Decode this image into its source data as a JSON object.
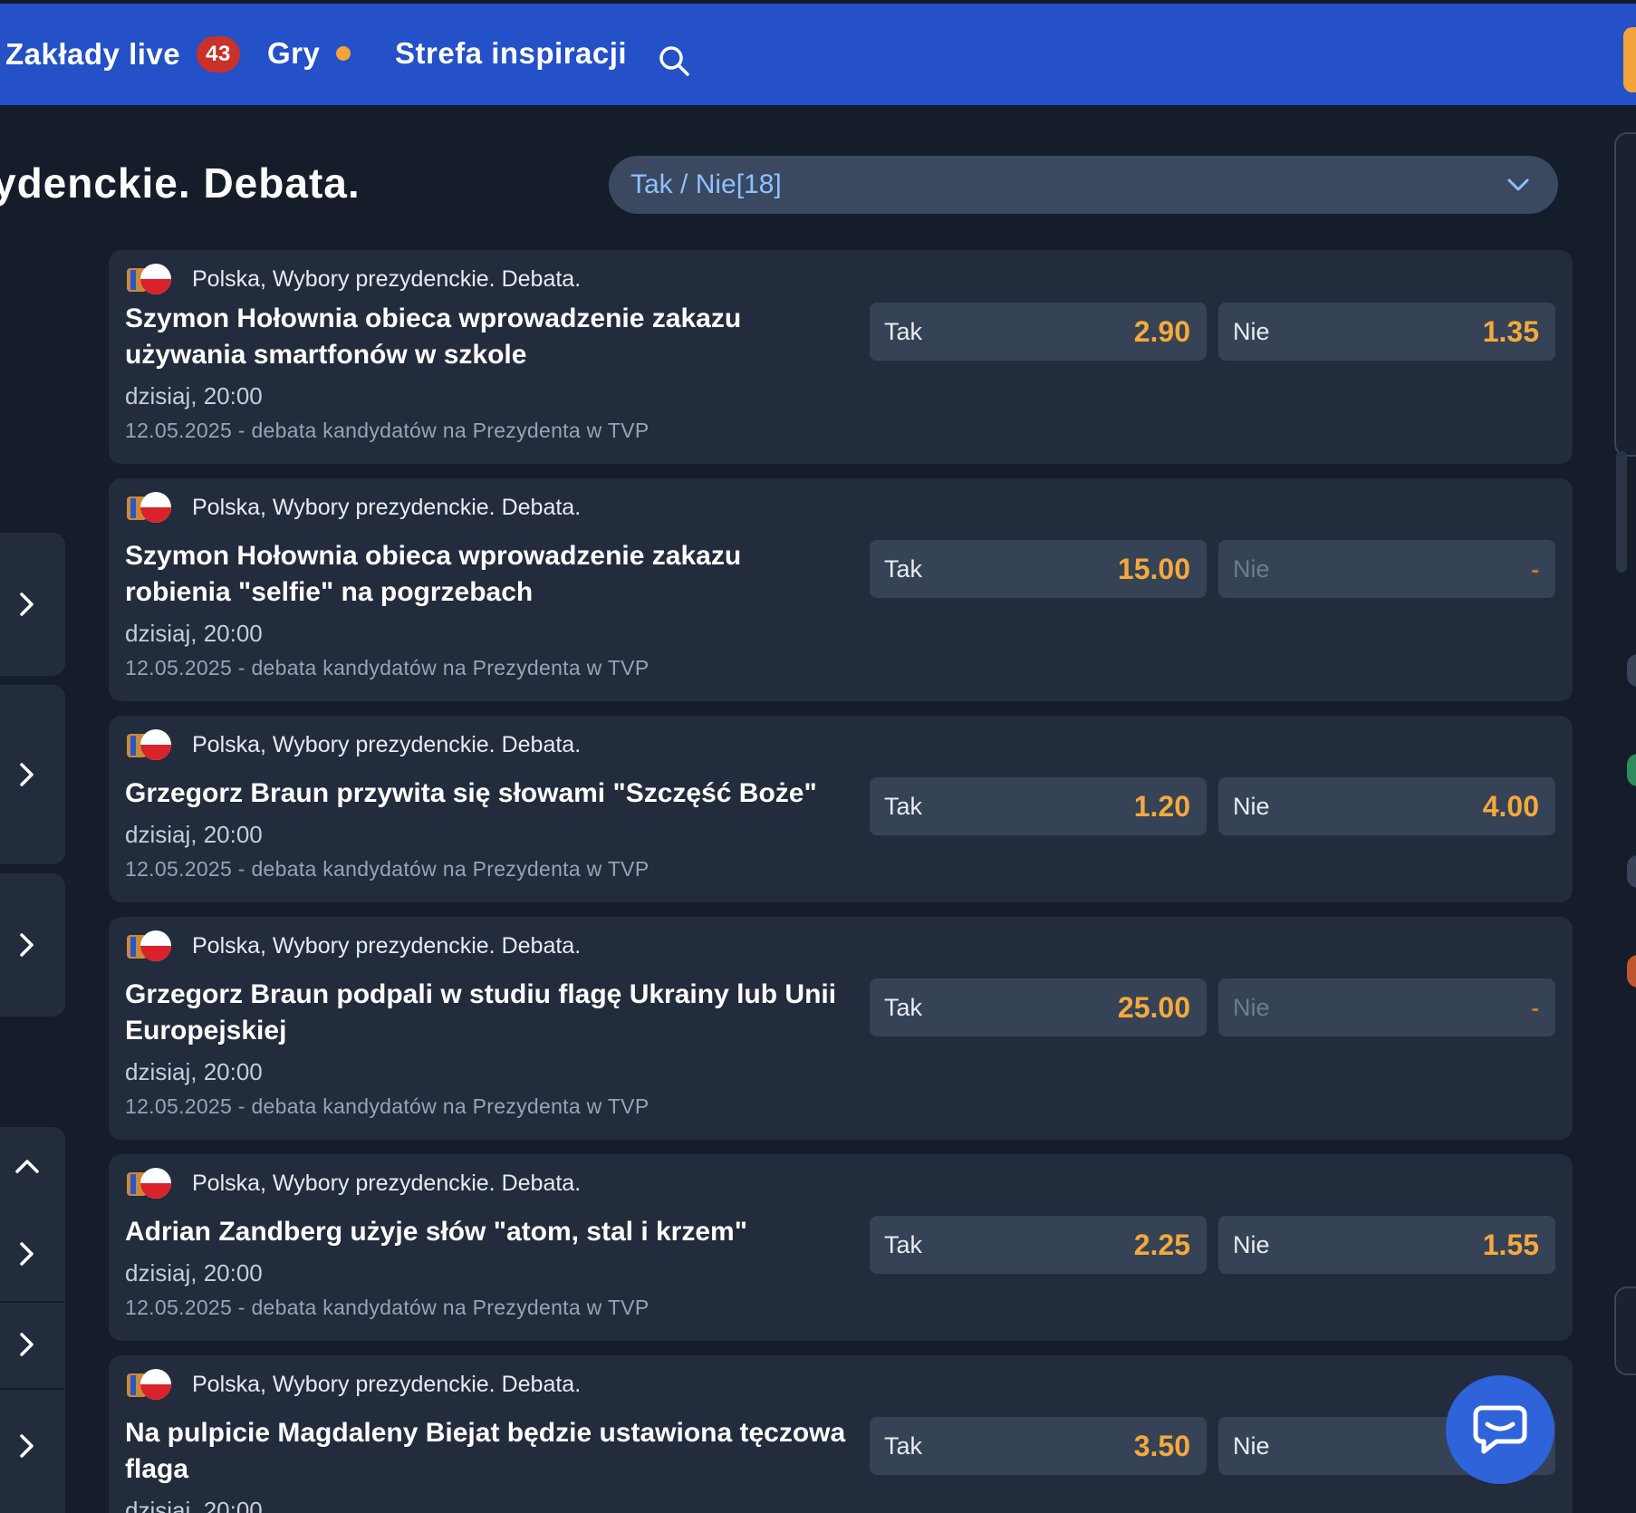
{
  "nav": {
    "items": [
      {
        "label": "Zakłady live",
        "badge": "43"
      },
      {
        "label": "Gry"
      },
      {
        "label": "Strefa inspiracji"
      }
    ]
  },
  "header": {
    "title": "ydenckie. Debata.",
    "market_select": "Tak / Nie[18]"
  },
  "events": [
    {
      "league": "Polska, Wybory prezydenckie. Debata.",
      "title": "Szymon Hołownia obieca wprowadzenie zakazu używania smartfonów w szkole",
      "time": "dzisiaj, 20:00",
      "desc": "12.05.2025 - debata kandydatów na Prezydenta w TVP",
      "odds": [
        {
          "label": "Tak",
          "value": "2.90"
        },
        {
          "label": "Nie",
          "value": "1.35"
        }
      ]
    },
    {
      "league": "Polska, Wybory prezydenckie. Debata.",
      "title": "Szymon Hołownia obieca wprowadzenie zakazu robienia \"selfie\" na pogrzebach",
      "time": "dzisiaj, 20:00",
      "desc": "12.05.2025 - debata kandydatów na Prezydenta w TVP",
      "odds": [
        {
          "label": "Tak",
          "value": "15.00"
        },
        {
          "label": "Nie",
          "value": "-"
        }
      ]
    },
    {
      "league": "Polska, Wybory prezydenckie. Debata.",
      "title": "Grzegorz Braun przywita się słowami \"Szczęść Boże\"",
      "time": "dzisiaj, 20:00",
      "desc": "12.05.2025 - debata kandydatów na Prezydenta w TVP",
      "odds": [
        {
          "label": "Tak",
          "value": "1.20"
        },
        {
          "label": "Nie",
          "value": "4.00"
        }
      ]
    },
    {
      "league": "Polska, Wybory prezydenckie. Debata.",
      "title": "Grzegorz Braun podpali w studiu flagę Ukrainy lub Unii Europejskiej",
      "time": "dzisiaj, 20:00",
      "desc": "12.05.2025 - debata kandydatów na Prezydenta w TVP",
      "odds": [
        {
          "label": "Tak",
          "value": "25.00"
        },
        {
          "label": "Nie",
          "value": "-"
        }
      ]
    },
    {
      "league": "Polska, Wybory prezydenckie. Debata.",
      "title": "Adrian Zandberg użyje słów \"atom, stal i krzem\"",
      "time": "dzisiaj, 20:00",
      "desc": "12.05.2025 - debata kandydatów na Prezydenta w TVP",
      "odds": [
        {
          "label": "Tak",
          "value": "2.25"
        },
        {
          "label": "Nie",
          "value": "1.55"
        }
      ]
    },
    {
      "league": "Polska, Wybory prezydenckie. Debata.",
      "title": "Na pulpicie Magdaleny Biejat będzie ustawiona tęczowa flaga",
      "time": "dzisiaj, 20:00",
      "desc": "",
      "odds": [
        {
          "label": "Tak",
          "value": "3.50"
        },
        {
          "label": "Nie",
          "value": ""
        }
      ]
    }
  ],
  "colors": {
    "topbar": "#2450c8",
    "background": "#151c2a",
    "card": "#232c3d",
    "odd_button": "#364256",
    "odd_value": "#f3a93c",
    "badge": "#c8322a",
    "dot": "#f2a33a"
  },
  "icons": [
    "search-icon",
    "chevron-down-icon",
    "chevron-right-icon",
    "chevron-up-icon",
    "flag-icon",
    "chat-icon"
  ]
}
